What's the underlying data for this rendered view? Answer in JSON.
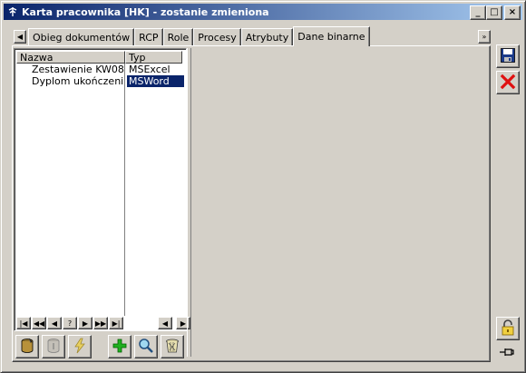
{
  "window": {
    "title": "Karta pracownika [HK] - zostanie zmieniona",
    "app_icon": "tree-icon",
    "minimize_label": "_",
    "maximize_label": "□",
    "close_label": "×"
  },
  "tabs": [
    {
      "label": "Obieg dokumentów"
    },
    {
      "label": "RCP"
    },
    {
      "label": "Role"
    },
    {
      "label": "Procesy"
    },
    {
      "label": "Atrybuty"
    },
    {
      "label": "Dane binarne",
      "active": true
    }
  ],
  "tab_scroll": {
    "left": "◀",
    "right": "»"
  },
  "table": {
    "columns": [
      "Nazwa",
      "Typ"
    ],
    "rows": [
      {
        "name": "Zestawienie KW08",
        "type": "MSExcel",
        "selected": false
      },
      {
        "name": "Dyplom ukończenia k",
        "type": "MSWord",
        "selected": true
      }
    ]
  },
  "navigator": {
    "buttons": [
      "|◀",
      "◀◀",
      "◀",
      "?",
      "▶",
      "▶▶",
      "▶|"
    ],
    "hscroll_left": "◀",
    "hscroll_right": "▶"
  },
  "toolbar": {
    "icons": [
      "database-icon",
      "database-disabled-icon",
      "lightning-icon",
      "add-icon",
      "search-icon",
      "trash-icon"
    ]
  },
  "side": {
    "icons": [
      "save-icon",
      "cancel-icon",
      "unlock-icon",
      "pin-icon"
    ]
  },
  "colors": {
    "titlebar_start": "#0a246a",
    "titlebar_end": "#a6caf0",
    "selection": "#0a246a",
    "face": "#d4d0c8"
  }
}
